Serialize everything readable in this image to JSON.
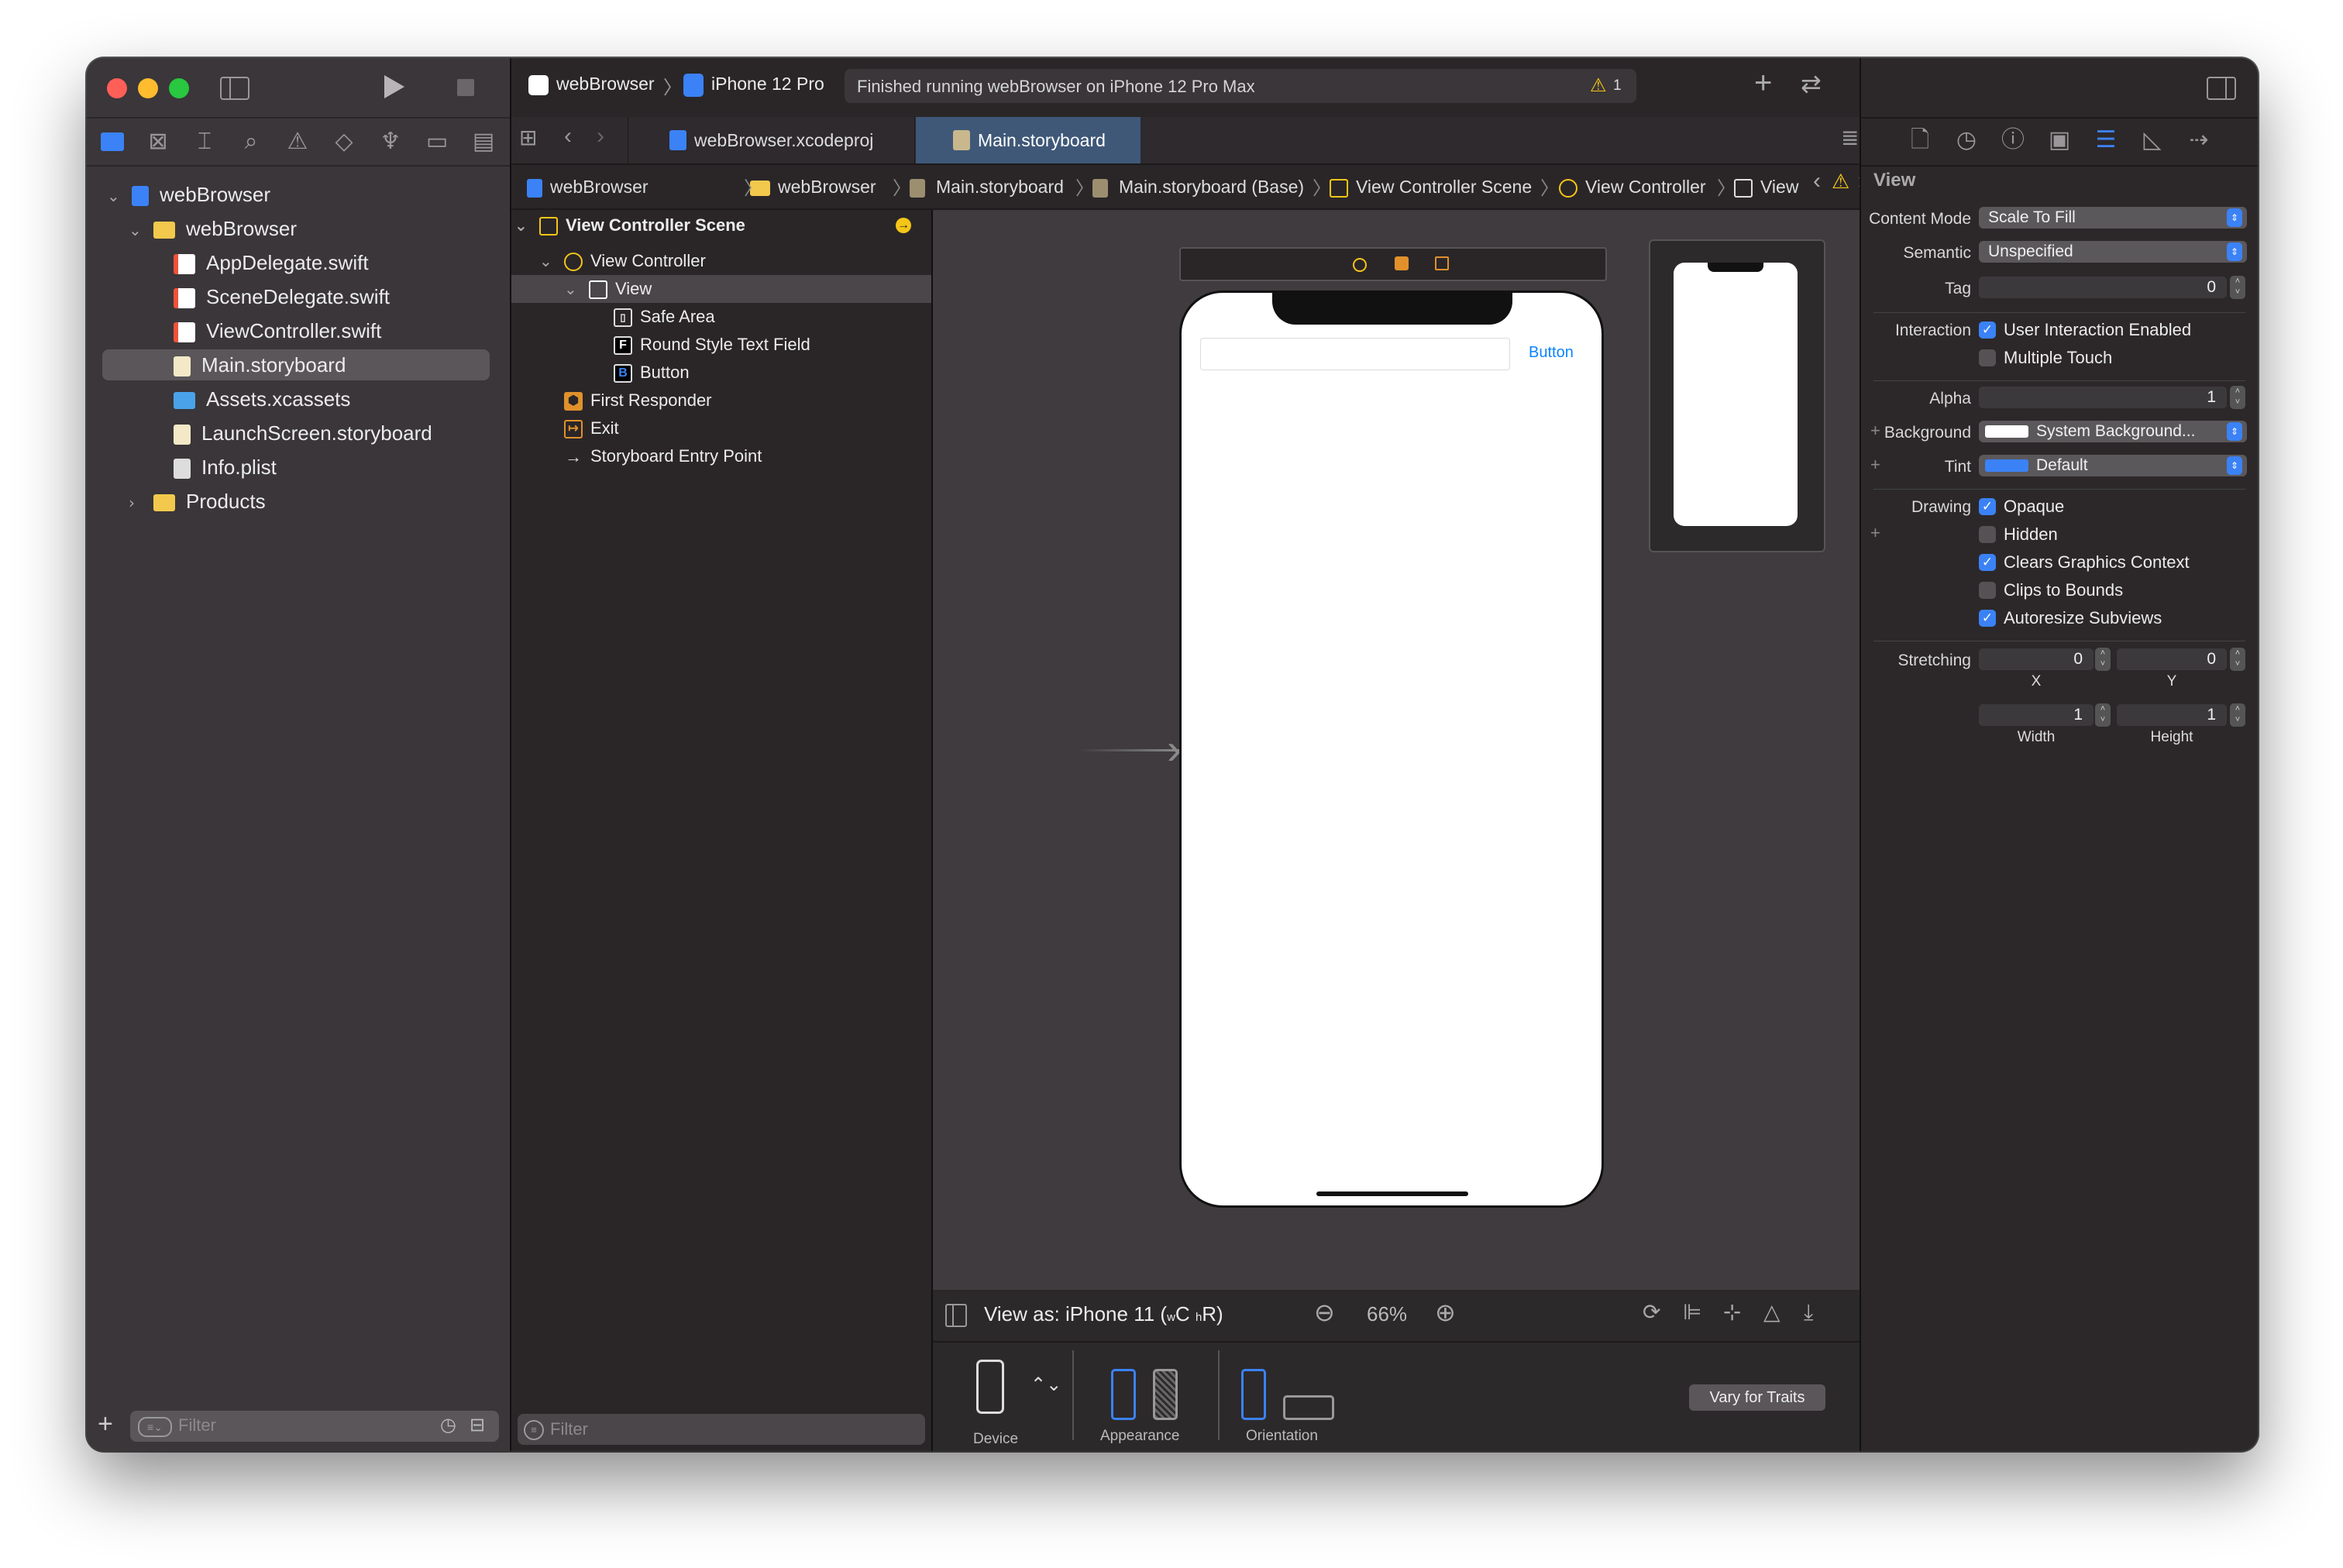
{
  "toolbar": {
    "scheme_name": "webBrowser",
    "device_name": "iPhone 12 Pro",
    "status_text": "Finished running webBrowser on iPhone 12 Pro Max",
    "warning_count": "1"
  },
  "tabs": [
    {
      "label": "webBrowser.xcodeproj"
    },
    {
      "label": "Main.storyboard"
    }
  ],
  "navigator": {
    "items": [
      {
        "label": "webBrowser",
        "kind": "project"
      },
      {
        "label": "webBrowser",
        "kind": "folder"
      },
      {
        "label": "AppDelegate.swift",
        "kind": "swift"
      },
      {
        "label": "SceneDelegate.swift",
        "kind": "swift"
      },
      {
        "label": "ViewController.swift",
        "kind": "swift"
      },
      {
        "label": "Main.storyboard",
        "kind": "storyboard"
      },
      {
        "label": "Assets.xcassets",
        "kind": "assets"
      },
      {
        "label": "LaunchScreen.storyboard",
        "kind": "storyboard"
      },
      {
        "label": "Info.plist",
        "kind": "plist"
      },
      {
        "label": "Products",
        "kind": "folder"
      }
    ],
    "filter_placeholder": "Filter"
  },
  "breadcrumb": [
    "webBrowser",
    "webBrowser",
    "Main.storyboard",
    "Main.storyboard (Base)",
    "View Controller Scene",
    "View Controller",
    "View"
  ],
  "outline": {
    "items": [
      {
        "label": "View Controller Scene"
      },
      {
        "label": "View Controller"
      },
      {
        "label": "View"
      },
      {
        "label": "Safe Area"
      },
      {
        "label": "Round Style Text Field"
      },
      {
        "label": "Button"
      },
      {
        "label": "First Responder"
      },
      {
        "label": "Exit"
      },
      {
        "label": "Storyboard Entry Point"
      }
    ],
    "filter_placeholder": "Filter"
  },
  "canvas": {
    "button_label": "Button",
    "view_as": "View as: iPhone 11 (",
    "traits_w": "w",
    "traits_c": "C",
    "traits_h": "h",
    "traits_r": "R)",
    "zoom": "66%",
    "device_label": "Device",
    "appearance_label": "Appearance",
    "orientation_label": "Orientation",
    "vary_button": "Vary for Traits"
  },
  "inspector": {
    "title": "View",
    "content_mode_label": "Content Mode",
    "content_mode_value": "Scale To Fill",
    "semantic_label": "Semantic",
    "semantic_value": "Unspecified",
    "tag_label": "Tag",
    "tag_value": "0",
    "interaction_label": "Interaction",
    "user_interaction": "User Interaction Enabled",
    "multiple_touch": "Multiple Touch",
    "alpha_label": "Alpha",
    "alpha_value": "1",
    "background_label": "Background",
    "background_value": "System Background...",
    "tint_label": "Tint",
    "tint_value": "Default",
    "drawing_label": "Drawing",
    "opaque": "Opaque",
    "hidden": "Hidden",
    "clears": "Clears Graphics Context",
    "clips": "Clips to Bounds",
    "autoresize": "Autoresize Subviews",
    "stretching_label": "Stretching",
    "stretch_x_value": "0",
    "stretch_y_value": "0",
    "x_label": "X",
    "y_label": "Y",
    "stretch_w_value": "1",
    "stretch_h_value": "1",
    "width_label": "Width",
    "height_label": "Height"
  },
  "colors": {
    "accent": "#3b82f6",
    "warning": "#f5c518",
    "close": "#ff5f57",
    "minimize": "#febc2e",
    "zoom": "#28c840",
    "folder": "#f2c94c",
    "swift": "#f05138"
  }
}
